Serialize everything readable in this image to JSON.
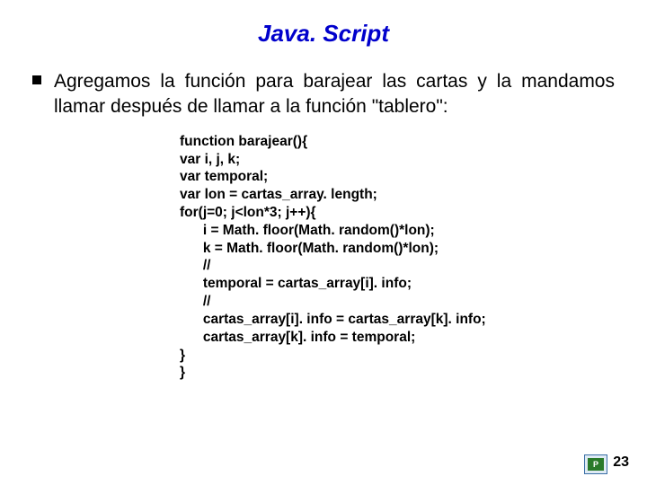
{
  "title": "Java. Script",
  "bullet": "Agregamos la función para barajear las cartas y la mandamos llamar después de llamar a la función \"tablero\":",
  "code": {
    "l01": "function barajear(){",
    "l02": "var i, j, k;",
    "l03": "var temporal;",
    "l04": "var lon = cartas_array. length;",
    "l05": "for(j=0; j<lon*3; j++){",
    "l06": "      i = Math. floor(Math. random()*lon);",
    "l07": "      k = Math. floor(Math. random()*lon);",
    "l08": "      //",
    "l09": "      temporal = cartas_array[i]. info;",
    "l10": "      //",
    "l11": "      cartas_array[i]. info = cartas_array[k]. info;",
    "l12": "      cartas_array[k]. info = temporal;",
    "l13": "}",
    "l14": "}"
  },
  "page_number": "23",
  "logo_text": "P"
}
